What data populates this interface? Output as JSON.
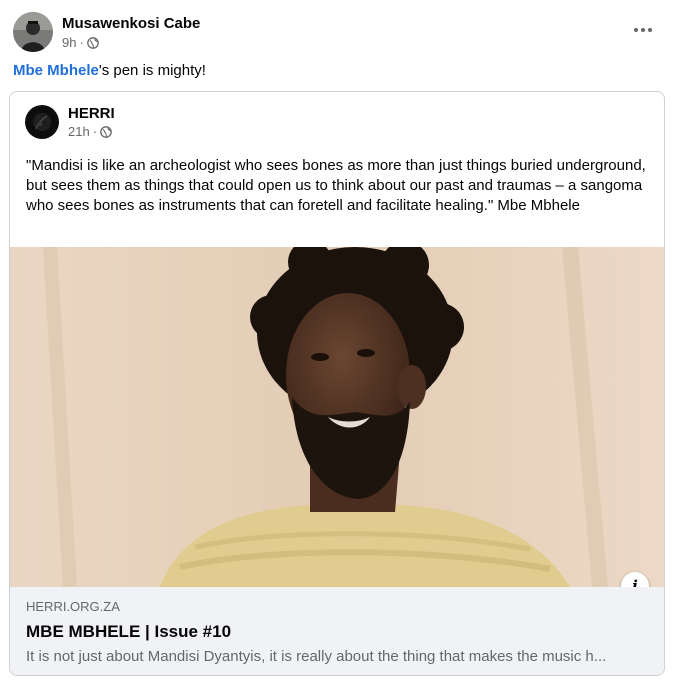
{
  "post": {
    "author": "Musawenkosi Cabe",
    "time": "9h",
    "separator": "·",
    "privacy_icon": "globe-icon",
    "menu_icon": "more-options-icon",
    "text": {
      "mention": "Mbe Mbhele",
      "rest": "'s pen is mighty!"
    }
  },
  "shared_post": {
    "author": "HERRI",
    "time": "21h",
    "separator": "·",
    "privacy_icon": "globe-icon",
    "quote": "\"Mandisi is like an archeologist who sees bones as more than just things buried underground, but sees them as things that could open us to think about our past and traumas – a sangoma who sees bones as instruments that can foretell and facilitate healing.\" Mbe Mbhele"
  },
  "link_preview": {
    "domain": "HERRI.ORG.ZA",
    "title": "MBE MBHELE | Issue #10",
    "description": "It is not just about Mandisi Dyantyis, it is really about the thing that makes the music h...",
    "info_icon": "info-icon",
    "info_glyph": "i"
  },
  "colors": {
    "mention": "#216fdb",
    "secondary_text": "#65676b",
    "footer_bg": "#f0f2f5",
    "border": "#ced0d4"
  }
}
